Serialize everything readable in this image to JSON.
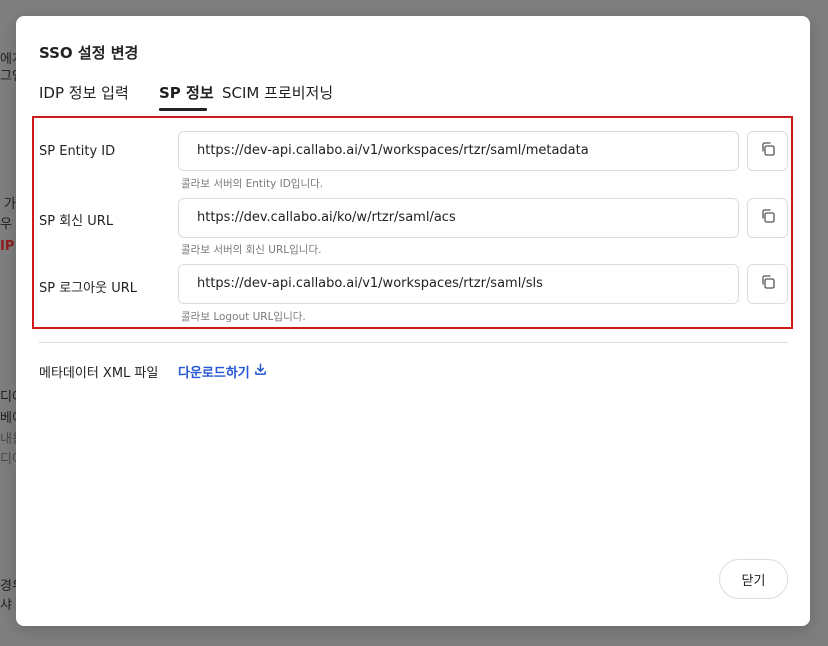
{
  "background": {
    "fragments": [
      {
        "text": "에게",
        "style": "normal"
      },
      {
        "text": "그인",
        "style": "normal"
      },
      {
        "text": "가",
        "style": "normal"
      },
      {
        "text": "우",
        "style": "normal"
      },
      {
        "text": "IP",
        "style": "red"
      },
      {
        "text": "디어",
        "style": "normal"
      },
      {
        "text": "베이",
        "style": "normal"
      },
      {
        "text": "내용",
        "style": "gray"
      },
      {
        "text": "디어",
        "style": "gray"
      },
      {
        "text": "경우",
        "style": "normal"
      },
      {
        "text": "샤 새",
        "style": "normal"
      }
    ]
  },
  "modal": {
    "title": "SSO 설정 변경",
    "tabs": [
      {
        "label": "IDP 정보 입력",
        "active": false
      },
      {
        "label": "SP 정보",
        "active": true
      },
      {
        "label": "SCIM 프로비저닝",
        "active": false
      }
    ],
    "sp_rows": [
      {
        "label": "SP Entity ID",
        "value": "https://dev-api.callabo.ai/v1/workspaces/rtzr/saml/metadata",
        "hint": "콜라보 서버의 Entity ID입니다."
      },
      {
        "label": "SP 회신 URL",
        "value": "https://dev.callabo.ai/ko/w/rtzr/saml/acs",
        "hint": "콜라보 서버의 회신 URL입니다."
      },
      {
        "label": "SP 로그아웃 URL",
        "value": "https://dev-api.callabo.ai/v1/workspaces/rtzr/saml/sls",
        "hint": "콜라보 Logout URL입니다."
      }
    ],
    "metadata": {
      "label": "메타데이터 XML 파일",
      "download_label": "다운로드하기"
    },
    "close_label": "닫기"
  },
  "icons": {
    "copy": "copy-icon",
    "download": "download-icon"
  },
  "colors": {
    "highlight_border": "#d01a1a",
    "link": "#2456d6",
    "overlay": "#7f7f7f"
  }
}
